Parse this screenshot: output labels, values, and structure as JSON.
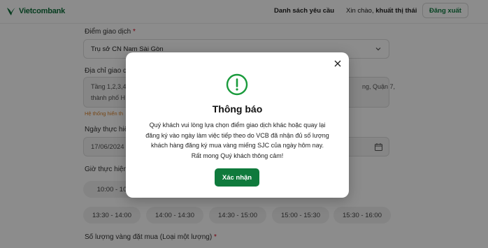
{
  "header": {
    "logo_text": "Vietcombank",
    "nav_requests": "Danh sách yêu cầu",
    "greeting_prefix": "Xin chào, ",
    "greeting_name": "khuất thị thái",
    "logout_label": "Đăng xuất",
    "brand_color": "#0d6e3a"
  },
  "form": {
    "branch_label": "Điểm giao dịch",
    "required_mark": "*",
    "branch_value": "Trụ sở CN Nam Sài Gòn",
    "address_label": "Địa chỉ giao dị",
    "address_line1": "Tầng 1,2,3,4",
    "address_line1_end": "ng, Quận 7,",
    "address_line2": "thành phố H",
    "address_hint": "Hệ thống hiển th",
    "date_label": "Ngày thực hiệ",
    "date_value": "17/06/2024",
    "time_label": "Giờ thực hiện",
    "time_slots_row1": [
      "10:00 - 10"
    ],
    "time_slots_row2": [
      "13:30 - 14:00",
      "14:00 - 14:30",
      "14:30 - 15:00",
      "15:00 - 15:30",
      "15:30 - 16:00"
    ],
    "quantity_label": "Số lượng vàng đặt mua (Loại một lượng)",
    "quantity_required": "*"
  },
  "modal": {
    "icon": "exclamation-circle-icon",
    "accent_color": "#1a9b3c",
    "title": "Thông báo",
    "message_lines": [
      "Quý khách vui lòng lựa chọn điểm giao dịch khác hoặc quay lại",
      "đăng ký vào ngày làm việc tiếp theo do VCB đã nhận đủ số lượng",
      "khách hàng đăng ký mua vàng miếng SJC của ngày hôm nay.",
      "Rất mong Quý khách thông cảm!"
    ],
    "confirm_label": "Xác nhận"
  }
}
